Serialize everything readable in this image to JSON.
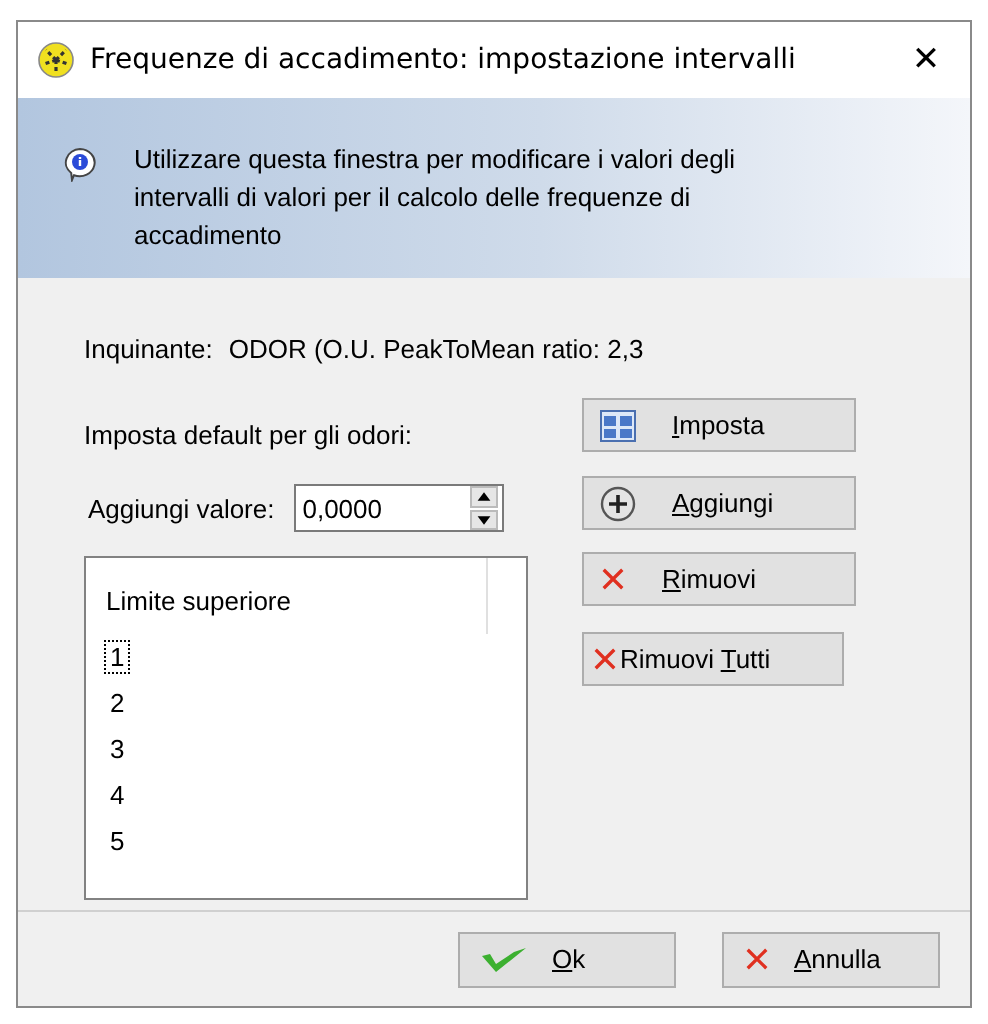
{
  "window": {
    "title": "Frequenze di accadimento: impostazione intervalli",
    "close": "✕"
  },
  "banner": {
    "text": "Utilizzare questa finestra per modificare i valori degli intervalli di valori per il calcolo delle frequenze di accadimento"
  },
  "pollutant": {
    "label": "Inquinante:",
    "value": "ODOR (O.U. PeakToMean ratio: 2,3"
  },
  "defaults": {
    "label": "Imposta default per gli odori:"
  },
  "add_value": {
    "label": "Aggiungi valore:",
    "value": "0,0000"
  },
  "list": {
    "column": "Limite superiore",
    "items": [
      {
        "text": "1",
        "selected": true
      },
      {
        "text": "2",
        "selected": false
      },
      {
        "text": "3",
        "selected": false
      },
      {
        "text": "4",
        "selected": false
      },
      {
        "text": "5",
        "selected": false
      }
    ]
  },
  "side_buttons": [
    {
      "kind": "grid",
      "key": "I",
      "after": "mposta"
    },
    {
      "kind": "plus",
      "key": "A",
      "after": "ggiungi"
    },
    {
      "kind": "cross",
      "key": "R",
      "after": "imuovi"
    },
    {
      "kind": "cross-tight",
      "before": "Rimuovi ",
      "key": "T",
      "after": "utti"
    }
  ],
  "footer_buttons": [
    {
      "kind": "check",
      "key": "O",
      "after": "k"
    },
    {
      "kind": "cross",
      "key": "A",
      "after": "nnulla"
    }
  ]
}
